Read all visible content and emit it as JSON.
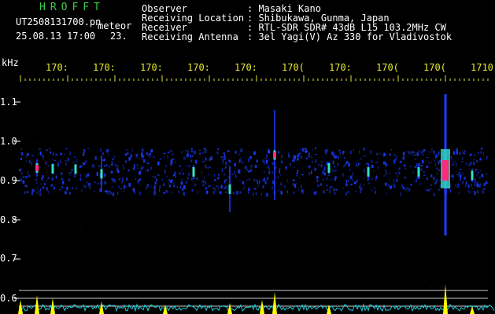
{
  "header": {
    "program": "HROFFT",
    "filename": "UT2508131700.pn",
    "mode": "meteor",
    "datetime": "25.08.13 17:00",
    "count": "23.",
    "fields": [
      {
        "label": "Observer",
        "value": ": Masaki Kano"
      },
      {
        "label": "Receiving Location",
        "value": ": Shibukawa, Gunma, Japan"
      },
      {
        "label": "Receiver",
        "value": ": RTL-SDR SDR# 43dB L15 103.2MHz CW"
      },
      {
        "label": "Receiving Antenna",
        "value": ": 3el Yagi(V) Az 330 for Vladivostok"
      }
    ]
  },
  "axis": {
    "y_unit": "kHz",
    "y_ticks": [
      "1.1",
      "1.0",
      "0.9",
      "0.8",
      "0.7",
      "0.6"
    ],
    "x_ticks": [
      "170:",
      "170:",
      "170:",
      "170:",
      "170:",
      "170(",
      "170:",
      "170(",
      "170(",
      "1710"
    ]
  },
  "colors": {
    "background": "#000000",
    "text": "#ffffff",
    "title": "#3cd04a",
    "axis_text": "#e8e830",
    "tick": "#e8e830",
    "noise": "#1a3cff",
    "signal_hot": "#ff2a7a",
    "signal_warm": "#33e0c8",
    "power_trace": "#1fd0e0",
    "power_peak": "#ffff00",
    "guide_line": "#c8c8c8"
  }
}
